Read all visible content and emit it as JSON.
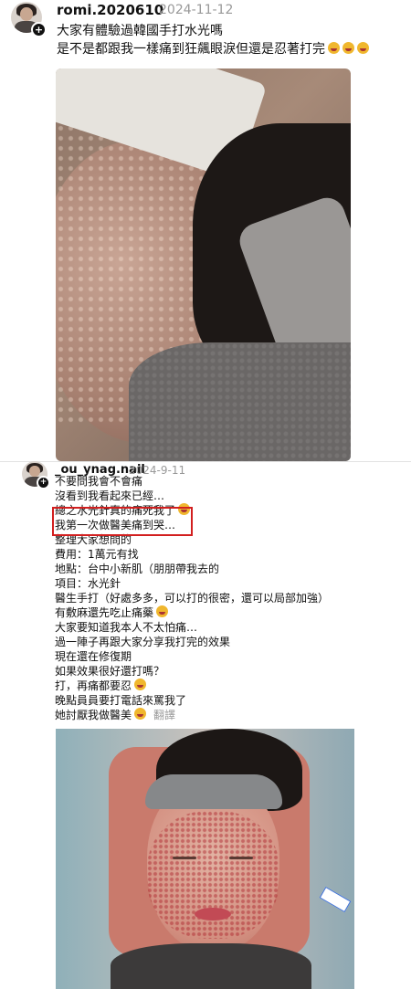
{
  "post1": {
    "username": "romi.2020610",
    "date": "2024-11-12",
    "caption_lines": [
      "大家有體驗過韓國手打水光嗎",
      "是不是都跟我一樣痛到狂飆眼淚但還是忍著打完"
    ],
    "caption_emojis": [
      "rolling-laughing-emoji",
      "rolling-laughing-emoji",
      "rolling-laughing-emoji"
    ]
  },
  "post2": {
    "username": "_ou_ynag.nail",
    "date": "2024-9-11",
    "lines": [
      "不要問我會不會痛",
      "沒看到我看起來已經…",
      "總之水光針真的痛死我了",
      "我第一次做醫美痛到哭…",
      "整理大家想問的",
      "費用：1萬元有找",
      "地點：台中小新肌（朋朋帶我去的",
      "項目：水光針",
      "醫生手打（好處多多，可以打的很密，還可以局部加強）",
      "有敷麻還先吃止痛藥",
      "大家要知道我本人不太怕痛…",
      "過一陣子再跟大家分享我打完的效果",
      "現在還在修復期",
      "如果效果很好還打嗎？",
      "打，再痛都要忍",
      "晚點員員要打電話來罵我了",
      "她討厭我做醫美"
    ],
    "translate_label": "翻譯"
  }
}
